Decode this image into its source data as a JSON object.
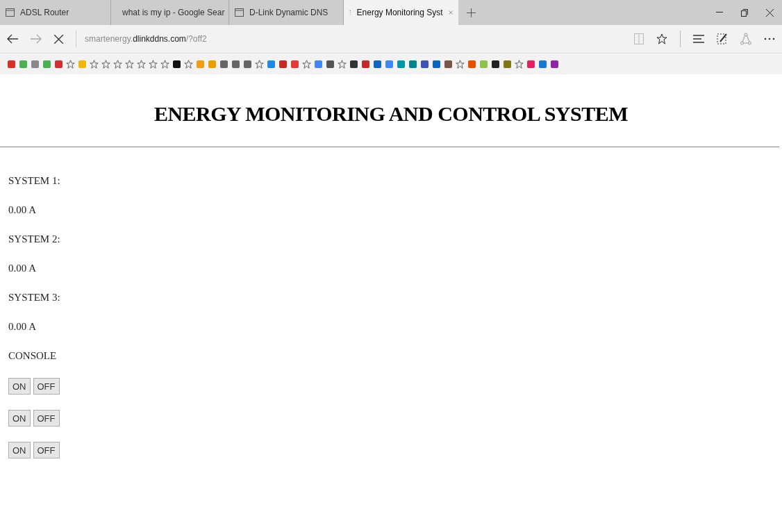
{
  "tabs": [
    {
      "label": "ADSL Router",
      "kind": "page",
      "selected": false
    },
    {
      "label": "what is my ip - Google Sear",
      "kind": "google",
      "selected": false
    },
    {
      "label": "D-Link Dynamic DNS",
      "kind": "page",
      "selected": false
    },
    {
      "label": "Energy Monitoring Syst",
      "kind": "loading",
      "selected": true
    }
  ],
  "address_bar": {
    "subdomain": "smartenergy.",
    "domain": "dlinkddns.com",
    "path": "/?off2"
  },
  "page": {
    "title": "ENERGY MONITORING AND CONTROL SYSTEM",
    "lines": [
      "SYSTEM 1:",
      "0.00 A",
      "SYSTEM 2:",
      "0.00 A",
      "SYSTEM 3:",
      "0.00 A",
      "CONSOLE"
    ],
    "button_rows": [
      [
        "ON",
        "OFF"
      ],
      [
        "ON",
        "OFF"
      ],
      [
        "ON",
        "OFF"
      ]
    ]
  }
}
